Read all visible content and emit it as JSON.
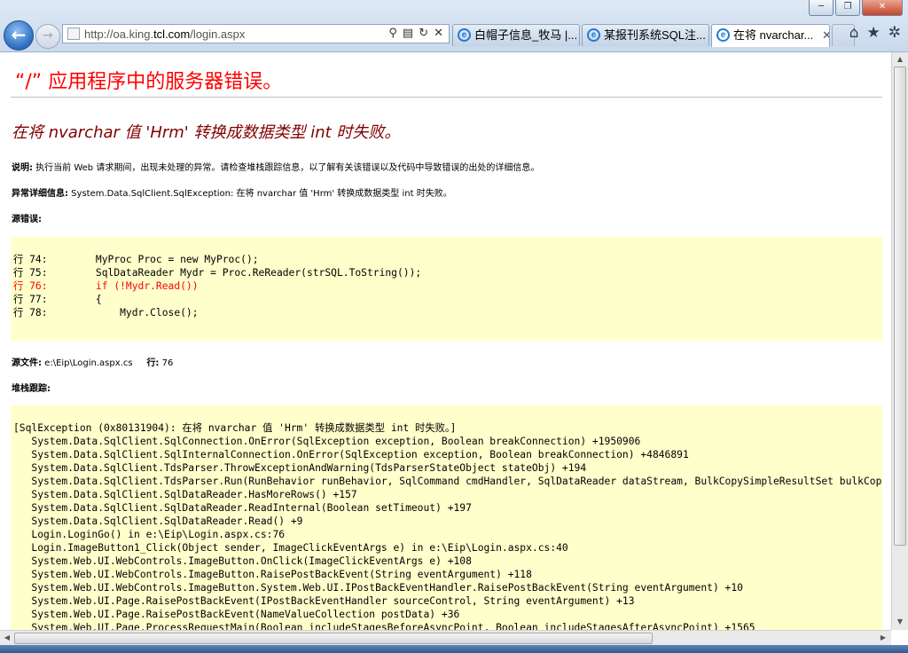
{
  "window": {
    "minimize_label": "─",
    "restore_label": "❐",
    "close_label": "✕"
  },
  "address_bar": {
    "url_prefix": "http://oa.king.",
    "url_domain": "tcl.com",
    "url_suffix": "/login.aspx",
    "search_icon": "⚲",
    "compat_icon": "▤",
    "refresh_icon": "↻",
    "stop_icon": "✕"
  },
  "tabs": [
    {
      "label": "白帽子信息_牧马 |...",
      "active": false
    },
    {
      "label": "某报刊系统SQL注...",
      "active": false
    },
    {
      "label": "在将 nvarchar...",
      "active": true,
      "close": "✕"
    }
  ],
  "toolbar_icons": {
    "home": "⌂",
    "favorites": "★",
    "tools": "✲"
  },
  "page": {
    "title": "“/” 应用程序中的服务器错误。",
    "subtitle": "在将 nvarchar 值 'Hrm' 转换成数据类型 int 时失败。",
    "desc_label": "说明:",
    "desc_text": " 执行当前 Web 请求期间，出现未处理的异常。请检查堆栈跟踪信息，以了解有关该错误以及代码中导致错误的出处的详细信息。",
    "exception_label": "异常详细信息:",
    "exception_text": " System.Data.SqlClient.SqlException: 在将 nvarchar 值 'Hrm' 转换成数据类型 int 时失败。",
    "source_error_label": "源错误:",
    "source_lines": [
      {
        "text": "行 74:        MyProc Proc = new MyProc();",
        "highlight": false
      },
      {
        "text": "行 75:        SqlDataReader Mydr = Proc.ReReader(strSQL.ToString());",
        "highlight": false
      },
      {
        "text": "行 76:        if (!Mydr.Read())",
        "highlight": true
      },
      {
        "text": "行 77:        {",
        "highlight": false
      },
      {
        "text": "行 78:            Mydr.Close();",
        "highlight": false
      }
    ],
    "source_file_label": "源文件:",
    "source_file_value": " e:\\Eip\\Login.aspx.cs",
    "line_label": "行:",
    "line_value": " 76",
    "stack_label": "堆栈跟踪:",
    "stack_lines": [
      "[SqlException (0x80131904): 在将 nvarchar 值 'Hrm' 转换成数据类型 int 时失败。]",
      "   System.Data.SqlClient.SqlConnection.OnError(SqlException exception, Boolean breakConnection) +1950906",
      "   System.Data.SqlClient.SqlInternalConnection.OnError(SqlException exception, Boolean breakConnection) +4846891",
      "   System.Data.SqlClient.TdsParser.ThrowExceptionAndWarning(TdsParserStateObject stateObj) +194",
      "   System.Data.SqlClient.TdsParser.Run(RunBehavior runBehavior, SqlCommand cmdHandler, SqlDataReader dataStream, BulkCopySimpleResultSet bulkCopyHandler",
      "   System.Data.SqlClient.SqlDataReader.HasMoreRows() +157",
      "   System.Data.SqlClient.SqlDataReader.ReadInternal(Boolean setTimeout) +197",
      "   System.Data.SqlClient.SqlDataReader.Read() +9",
      "   Login.LoginGo() in e:\\Eip\\Login.aspx.cs:76",
      "   Login.ImageButton1_Click(Object sender, ImageClickEventArgs e) in e:\\Eip\\Login.aspx.cs:40",
      "   System.Web.UI.WebControls.ImageButton.OnClick(ImageClickEventArgs e) +108",
      "   System.Web.UI.WebControls.ImageButton.RaisePostBackEvent(String eventArgument) +118",
      "   System.Web.UI.WebControls.ImageButton.System.Web.UI.IPostBackEventHandler.RaisePostBackEvent(String eventArgument) +10",
      "   System.Web.UI.Page.RaisePostBackEvent(IPostBackEventHandler sourceControl, String eventArgument) +13",
      "   System.Web.UI.Page.RaisePostBackEvent(NameValueCollection postData) +36",
      "   System.Web.UI.Page.ProcessRequestMain(Boolean includeStagesBeforeAsyncPoint, Boolean includeStagesAfterAsyncPoint) +1565"
    ]
  }
}
